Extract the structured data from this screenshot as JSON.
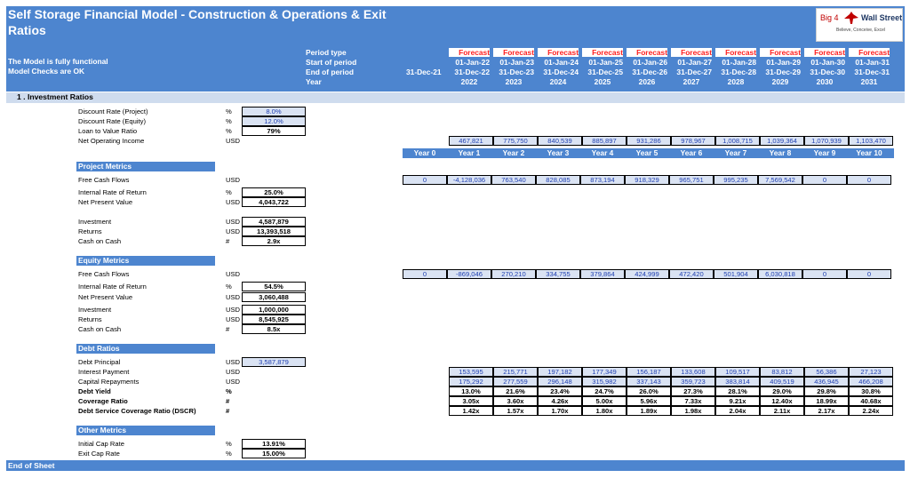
{
  "header": {
    "title": "Self Storage Financial Model - Construction & Operations & Exit",
    "subtitle": "Ratios",
    "status1": "The Model is fully functional",
    "status2": "Model Checks are OK",
    "row_labels": [
      "Period type",
      "Start of period",
      "End of period",
      "Year"
    ],
    "opening_end": "31-Dec-21",
    "logo": {
      "text_left": "Big 4",
      "text_right": "Wall Street",
      "tagline": "Believe, Conceive, Excel"
    }
  },
  "periods": [
    {
      "type": "Forecast",
      "start": "01-Jan-22",
      "end": "31-Dec-22",
      "year": "2022"
    },
    {
      "type": "Forecast",
      "start": "01-Jan-23",
      "end": "31-Dec-23",
      "year": "2023"
    },
    {
      "type": "Forecast",
      "start": "01-Jan-24",
      "end": "31-Dec-24",
      "year": "2024"
    },
    {
      "type": "Forecast",
      "start": "01-Jan-25",
      "end": "31-Dec-25",
      "year": "2025"
    },
    {
      "type": "Forecast",
      "start": "01-Jan-26",
      "end": "31-Dec-26",
      "year": "2026"
    },
    {
      "type": "Forecast",
      "start": "01-Jan-27",
      "end": "31-Dec-27",
      "year": "2027"
    },
    {
      "type": "Forecast",
      "start": "01-Jan-28",
      "end": "31-Dec-28",
      "year": "2028"
    },
    {
      "type": "Forecast",
      "start": "01-Jan-29",
      "end": "31-Dec-29",
      "year": "2029"
    },
    {
      "type": "Forecast",
      "start": "01-Jan-30",
      "end": "31-Dec-30",
      "year": "2030"
    },
    {
      "type": "Forecast",
      "start": "01-Jan-31",
      "end": "31-Dec-31",
      "year": "2031"
    }
  ],
  "section_title": "1 . Investment Ratios",
  "assumptions": [
    {
      "label": "Discount Rate (Project)",
      "unit": "%",
      "value": "8.0%",
      "input": true
    },
    {
      "label": "Discount Rate (Equity)",
      "unit": "%",
      "value": "12.0%",
      "input": true
    },
    {
      "label": "Loan to Value Ratio",
      "unit": "%",
      "value": "79%",
      "input": false
    }
  ],
  "noi": {
    "label": "Net Operating Income",
    "unit": "USD",
    "values": [
      "467,821",
      "775,750",
      "840,539",
      "885,897",
      "931,286",
      "978,967",
      "1,008,715",
      "1,039,364",
      "1,070,939",
      "1,103,470"
    ]
  },
  "year_labels": [
    "Year 0",
    "Year 1",
    "Year 2",
    "Year 3",
    "Year 4",
    "Year 5",
    "Year 6",
    "Year 7",
    "Year 8",
    "Year 9",
    "Year 10"
  ],
  "project": {
    "title": "Project Metrics",
    "fcf": {
      "label": "Free Cash Flows",
      "unit": "USD",
      "values": [
        "0",
        "-4,128,036",
        "763,540",
        "828,085",
        "873,194",
        "918,329",
        "965,751",
        "995,235",
        "7,569,542",
        "0",
        "0"
      ]
    },
    "metrics": [
      {
        "label": "Internal Rate of Return",
        "unit": "%",
        "value": "25.0%"
      },
      {
        "label": "Net Present Value",
        "unit": "USD",
        "value": "4,043,722"
      },
      {
        "label": "Investment",
        "unit": "USD",
        "value": "4,587,879"
      },
      {
        "label": "Returns",
        "unit": "USD",
        "value": "13,393,518"
      },
      {
        "label": "Cash on Cash",
        "unit": "#",
        "value": "2.9x"
      }
    ]
  },
  "equity": {
    "title": "Equity Metrics",
    "fcf": {
      "label": "Free Cash Flows",
      "unit": "USD",
      "values": [
        "0",
        "-869,046",
        "270,210",
        "334,755",
        "379,864",
        "424,999",
        "472,420",
        "501,904",
        "6,030,818",
        "0",
        "0"
      ]
    },
    "metrics": [
      {
        "label": "Internal Rate of Return",
        "unit": "%",
        "value": "54.5%"
      },
      {
        "label": "Net Present Value",
        "unit": "USD",
        "value": "3,060,488"
      },
      {
        "label": "Investment",
        "unit": "USD",
        "value": "1,000,000"
      },
      {
        "label": "Returns",
        "unit": "USD",
        "value": "8,545,925"
      },
      {
        "label": "Cash on Cash",
        "unit": "#",
        "value": "8.5x"
      }
    ]
  },
  "debt": {
    "title": "Debt Ratios",
    "principal": {
      "label": "Debt Principal",
      "unit": "USD",
      "value": "3,587,879"
    },
    "rows": [
      {
        "label": "Interest Payment",
        "unit": "USD",
        "input": true,
        "bold": false,
        "values": [
          "153,595",
          "215,771",
          "197,182",
          "177,349",
          "156,187",
          "133,608",
          "109,517",
          "83,812",
          "56,386",
          "27,123"
        ]
      },
      {
        "label": "Capital Repayments",
        "unit": "USD",
        "input": true,
        "bold": false,
        "values": [
          "175,292",
          "277,559",
          "296,148",
          "315,982",
          "337,143",
          "359,723",
          "383,814",
          "409,519",
          "436,945",
          "466,208"
        ]
      },
      {
        "label": "Debt Yield",
        "unit": "%",
        "input": false,
        "bold": true,
        "values": [
          "13.0%",
          "21.6%",
          "23.4%",
          "24.7%",
          "26.0%",
          "27.3%",
          "28.1%",
          "29.0%",
          "29.8%",
          "30.8%"
        ]
      },
      {
        "label": "Coverage Ratio",
        "unit": "#",
        "input": false,
        "bold": true,
        "values": [
          "3.05x",
          "3.60x",
          "4.26x",
          "5.00x",
          "5.96x",
          "7.33x",
          "9.21x",
          "12.40x",
          "18.99x",
          "40.68x"
        ]
      },
      {
        "label": "Debt Service Coverage Ratio (DSCR)",
        "unit": "#",
        "input": false,
        "bold": true,
        "values": [
          "1.42x",
          "1.57x",
          "1.70x",
          "1.80x",
          "1.89x",
          "1.98x",
          "2.04x",
          "2.11x",
          "2.17x",
          "2.24x"
        ]
      }
    ]
  },
  "other": {
    "title": "Other Metrics",
    "metrics": [
      {
        "label": "Initial Cap Rate",
        "unit": "%",
        "value": "13.91%"
      },
      {
        "label": "Exit Cap Rate",
        "unit": "%",
        "value": "15.00%"
      }
    ]
  },
  "footer": "End of Sheet"
}
